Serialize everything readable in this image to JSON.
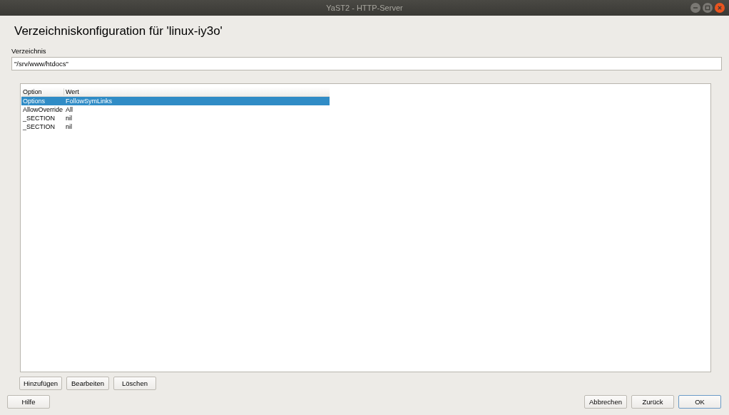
{
  "window": {
    "title": "YaST2 - HTTP-Server"
  },
  "heading": "Verzeichniskonfiguration für 'linux-iy3o'",
  "directory": {
    "label": "Verzeichnis",
    "value": "\"/srv/www/htdocs\""
  },
  "table": {
    "columns": [
      "Option",
      "Wert"
    ],
    "rows": [
      {
        "option": "Options",
        "value": "FollowSymLinks",
        "selected": true
      },
      {
        "option": "AllowOverride",
        "value": "All",
        "selected": false
      },
      {
        "option": "_SECTION",
        "value": "nil",
        "selected": false
      },
      {
        "option": "_SECTION",
        "value": "nil",
        "selected": false
      }
    ]
  },
  "table_buttons": [
    {
      "label": "Hinzufügen"
    },
    {
      "label": "Bearbeiten"
    },
    {
      "label": "Löschen"
    }
  ],
  "help_button": {
    "label": "Hilfe"
  },
  "nav_buttons": [
    {
      "label": "Abbrechen",
      "default": false
    },
    {
      "label": "Zurück",
      "default": false
    },
    {
      "label": "OK",
      "default": true
    }
  ]
}
